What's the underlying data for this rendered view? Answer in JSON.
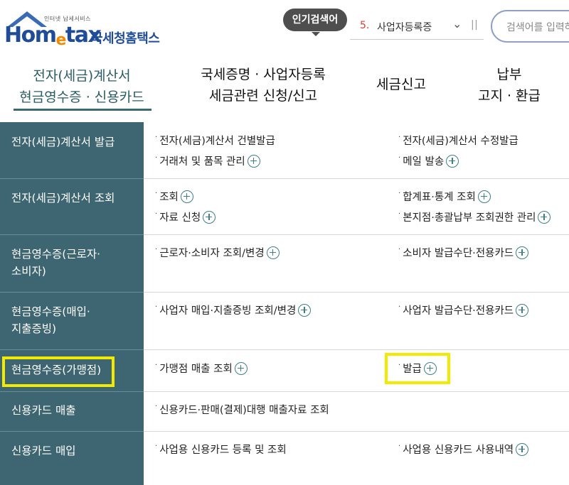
{
  "header": {
    "logo_tagline": "인터넷 납세서비스",
    "logo_word_a": "Hom",
    "logo_word_e": "e",
    "logo_word_b": "tax",
    "logo_ko": "국세청홈택스",
    "popular_label": "인기검색어",
    "popular_rank": "5.",
    "popular_term": "사업자등록증",
    "search_placeholder": "검색어를 입력하세요"
  },
  "tabs": [
    {
      "line1": "전자(세금)계산서",
      "line2": "현금영수증 · 신용카드"
    },
    {
      "line1": "국세증명 · 사업자등록",
      "line2": "세금관련 신청/신고"
    },
    {
      "line1": "세금신고",
      "line2": ""
    },
    {
      "line1": "납부",
      "line2": "고지 · 환급"
    }
  ],
  "menu": [
    {
      "category": [
        "전자(세금)계산서 발급"
      ],
      "left": [
        "전자(세금)계산서 건별발급",
        "거래처 및 품목 관리"
      ],
      "right": [
        "전자(세금)계산서 수정발급",
        "메일 발송"
      ]
    },
    {
      "category": [
        "전자(세금)계산서 조회"
      ],
      "left": [
        "조회",
        "자료 신청"
      ],
      "right": [
        "합계표·통계 조회",
        "본지점·총괄납부 조회권한 관리"
      ]
    },
    {
      "category": [
        "현금영수증(근로자·",
        "소비자)"
      ],
      "left": [
        "근로자·소비자 조회/변경"
      ],
      "right": [
        "소비자 발급수단·전용카드"
      ]
    },
    {
      "category": [
        "현금영수증(매입·",
        "지출증빙)"
      ],
      "left": [
        "사업자 매입·지출증빙 조회/변경"
      ],
      "right": [
        "사업자 발급수단·전용카드"
      ]
    },
    {
      "category": [
        "현금영수증(가맹점)"
      ],
      "left": [
        "가맹점 매출 조회"
      ],
      "right": [
        "발급"
      ]
    },
    {
      "category": [
        "신용카드 매출"
      ],
      "left": [
        "신용카드·판매(결제)대행 매출자료 조회"
      ],
      "right": []
    },
    {
      "category": [
        "신용카드 매입"
      ],
      "left": [
        "사업용 신용카드 등록 및 조회"
      ],
      "right": [
        "사업용 신용카드 사용내역"
      ]
    }
  ],
  "colors": {
    "sidebar": "#3d6672",
    "highlight": "#f2ea00",
    "brand": "#1e4c98",
    "accent": "#f08a00"
  }
}
